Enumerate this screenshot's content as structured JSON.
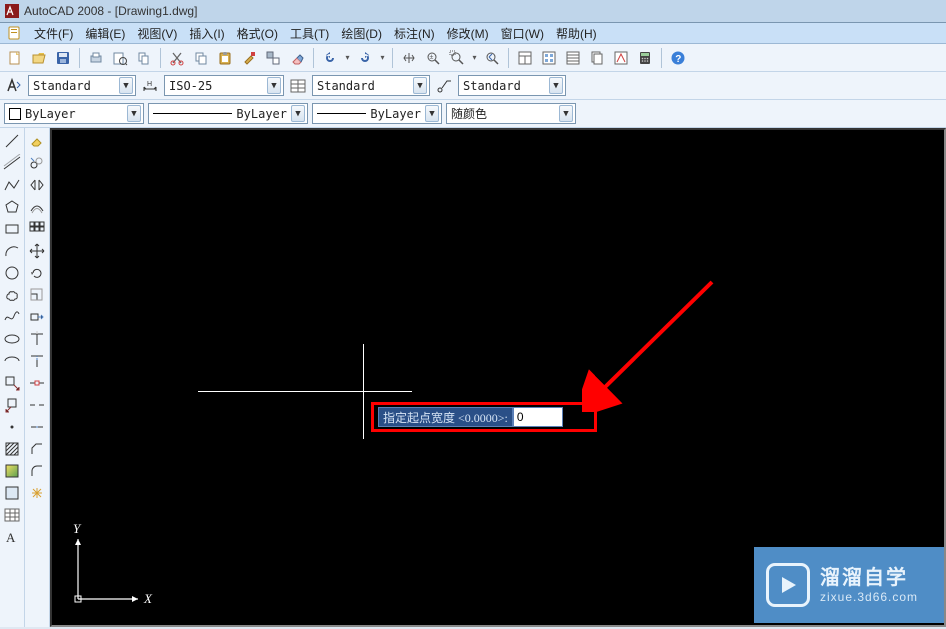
{
  "window": {
    "app": "AutoCAD 2008",
    "doc": "[Drawing1.dwg]"
  },
  "menus": [
    "文件(F)",
    "编辑(E)",
    "视图(V)",
    "插入(I)",
    "格式(O)",
    "工具(T)",
    "绘图(D)",
    "标注(N)",
    "修改(M)",
    "窗口(W)",
    "帮助(H)"
  ],
  "styles": {
    "textstyle": "Standard",
    "dimstyle": "ISO-25",
    "tablestyle": "Standard",
    "mlstyle": "Standard"
  },
  "layers": {
    "current": "ByLayer",
    "linetype": "ByLayer",
    "lineweight": "ByLayer",
    "color": "随颜色"
  },
  "dynamic_input": {
    "prompt": "指定起点宽度 <0.0000>:",
    "value": "0"
  },
  "ucs": {
    "x": "X",
    "y": "Y"
  },
  "watermark": {
    "brand": "溜溜自学",
    "url": "zixue.3d66.com"
  },
  "icons": {
    "new": "🗋",
    "open": "📂",
    "save": "💾",
    "plot": "🖨",
    "plotprev": "🔍",
    "publish": "📤",
    "cut": "✂",
    "copy": "⧉",
    "paste": "📋",
    "match": "🖌",
    "erase": "◧",
    "undo": "↶",
    "redo": "↷",
    "pan": "✋",
    "zoomrt": "🔍",
    "zoomwin": "⤢",
    "zoomprev": "🔎",
    "prop": "▣",
    "dc": "▦",
    "tp": "▥",
    "ssm": "▤",
    "mark": "◩",
    "calc": "🖩",
    "help": "?"
  }
}
